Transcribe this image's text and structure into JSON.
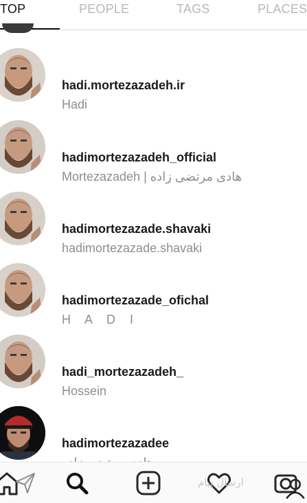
{
  "tabs": [
    {
      "label": "TOP",
      "active": true
    },
    {
      "label": "PEOPLE",
      "active": false
    },
    {
      "label": "TAGS",
      "active": false
    },
    {
      "label": "PLACES",
      "active": false
    }
  ],
  "results": [
    {
      "username": "hadi.mortezazadeh.ir",
      "fullname": "Hadi"
    },
    {
      "username": "hadimortezazadeh_official",
      "fullname": "Mortezazadeh | هادی مرتضی زاده"
    },
    {
      "username": "hadimortezazade.shavaki",
      "fullname": "hadimortezazade.shavaki"
    },
    {
      "username": "hadimortezazade_ofichal",
      "fullname": "H A D I"
    },
    {
      "username": "hadi_mortezazadeh_",
      "fullname": "Hossein"
    },
    {
      "username": "hadimortezazadee",
      "fullname": "هادی مرتضی زاده"
    }
  ],
  "bottom_nav": {
    "overlay_text": "ارسال پیام",
    "icons": [
      "home-icon",
      "send-icon",
      "search-icon",
      "add-icon",
      "heart-icon",
      "camera-icon",
      "profile-icon"
    ]
  },
  "colors": {
    "primary_text": "#1a1a1a",
    "secondary_text": "#8e8e8e",
    "inactive_tab": "#b8b8b8"
  }
}
